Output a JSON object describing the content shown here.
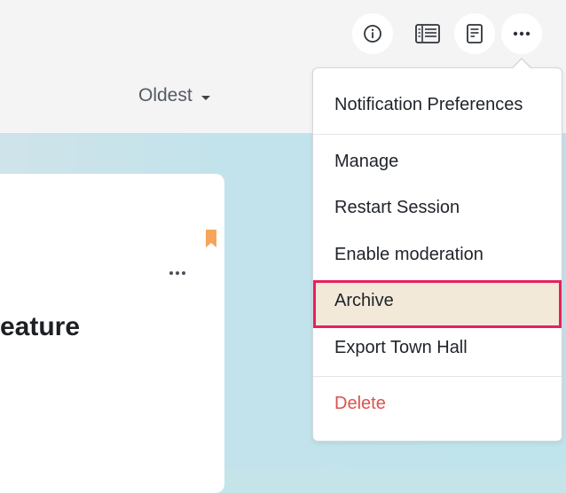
{
  "toolbar": {
    "icons": [
      "info-icon",
      "list-view-icon",
      "document-icon",
      "more-icon"
    ],
    "more_label": "•••"
  },
  "sort": {
    "label": "Oldest"
  },
  "card": {
    "title_fragment": "eature",
    "more_label": "•••",
    "bookmark_color": "#f5a55c"
  },
  "menu": {
    "items": [
      {
        "label": "Notification Preferences"
      },
      {
        "label": "Manage"
      },
      {
        "label": "Restart Session"
      },
      {
        "label": "Enable moderation"
      },
      {
        "label": "Archive"
      },
      {
        "label": "Export Town Hall"
      },
      {
        "label": "Delete"
      }
    ],
    "highlight_color": "#e8205c",
    "danger_color": "#d9534f"
  }
}
